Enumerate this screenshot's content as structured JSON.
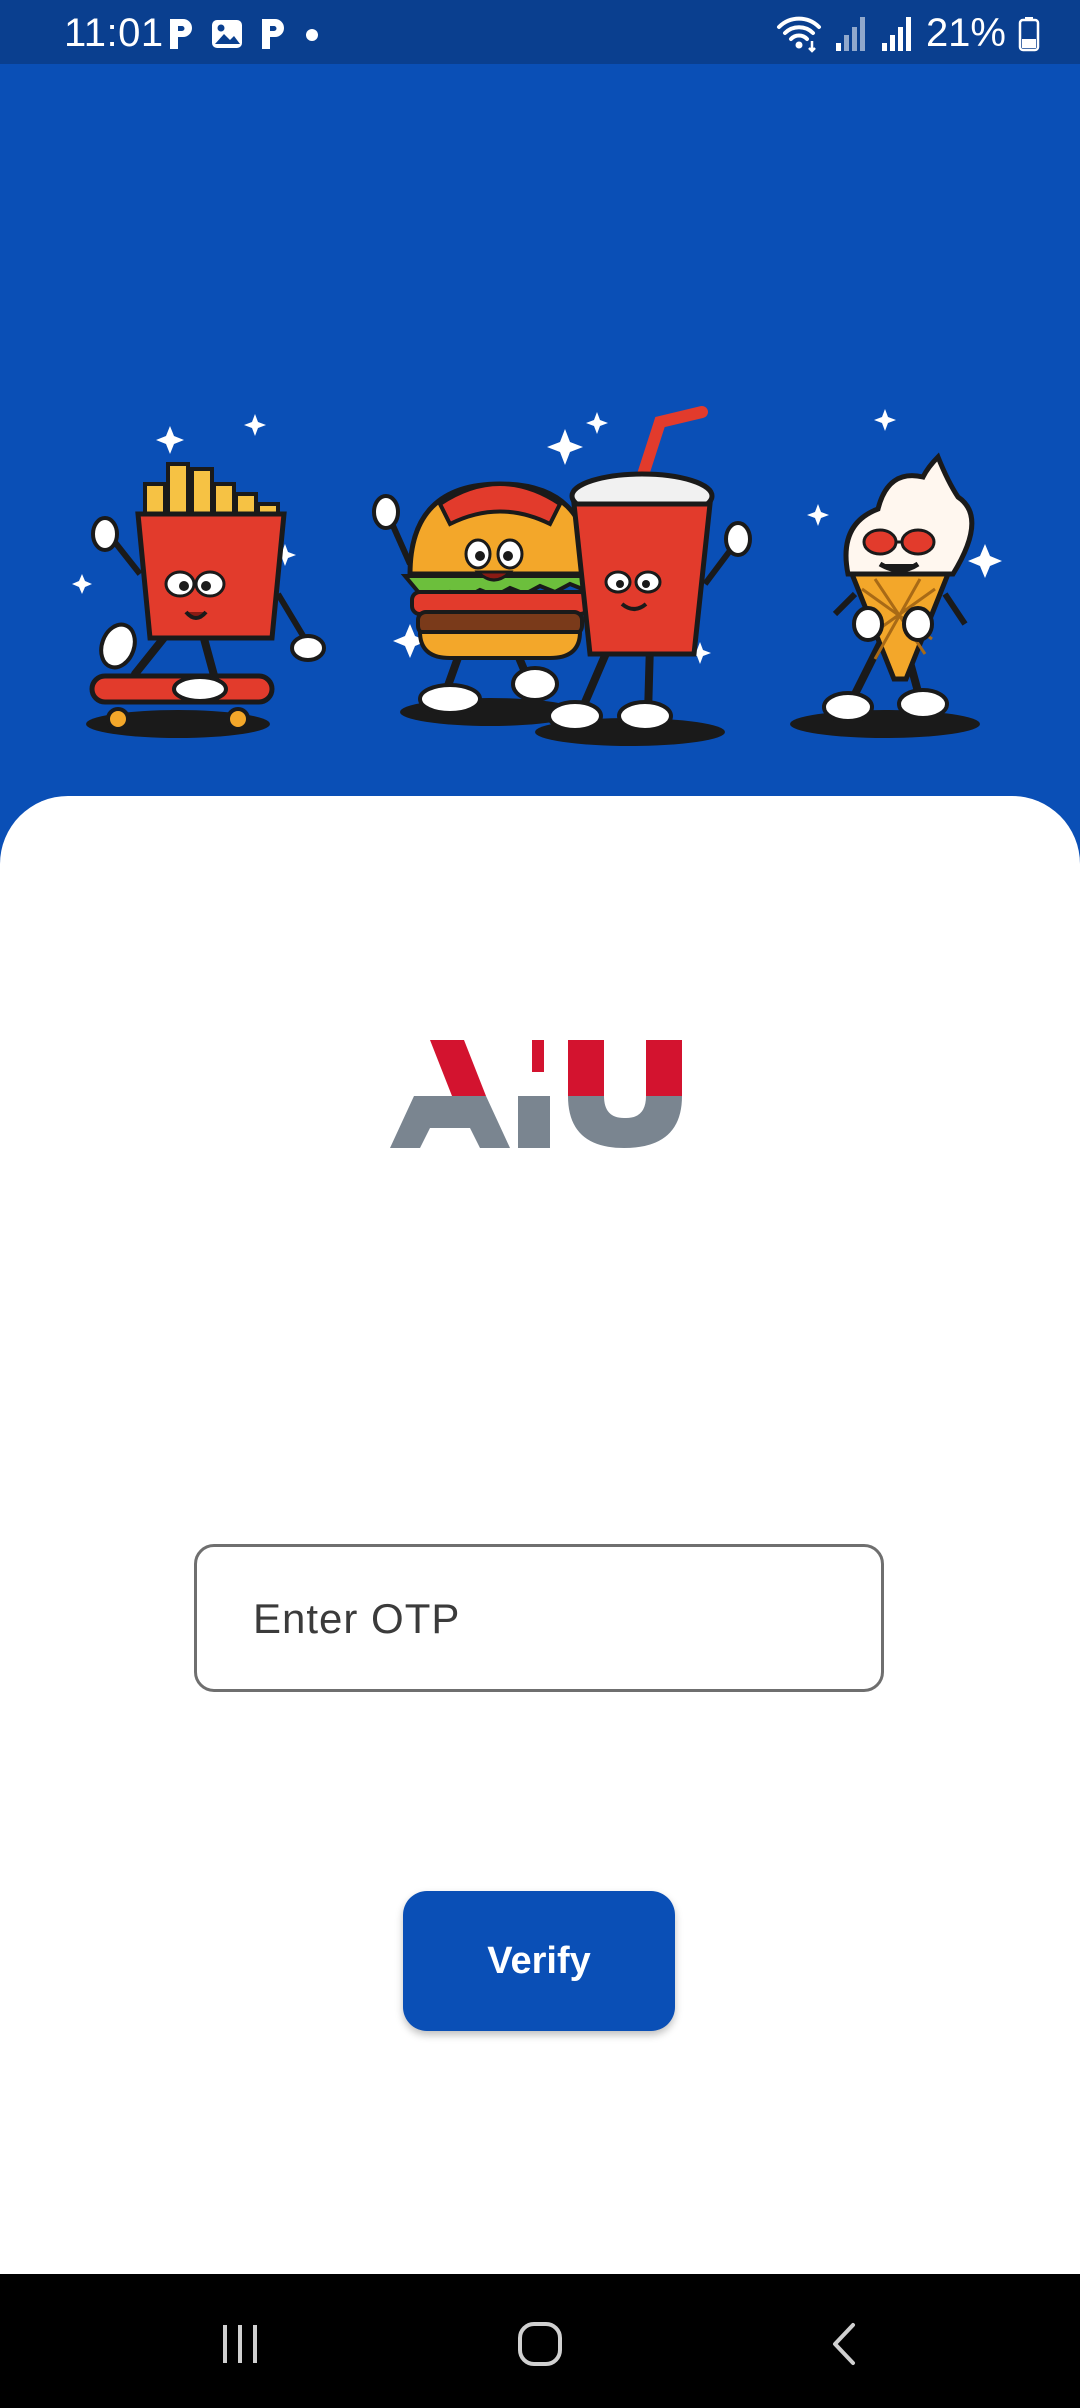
{
  "status_bar": {
    "time": "11:01",
    "battery": "21%",
    "left_icons": [
      "p-icon",
      "gallery-icon",
      "p-icon",
      "dot-icon"
    ],
    "right_icons": [
      "wifi-icon",
      "signal-icon",
      "signal-icon",
      "battery-icon"
    ]
  },
  "brand": {
    "logo_text": "ALU",
    "logo_red": "#d3132f",
    "logo_gray": "#7a8590"
  },
  "otp": {
    "placeholder": "Enter OTP",
    "value": ""
  },
  "verify_button": {
    "label": "Verify"
  },
  "colors": {
    "primary": "#0a4fb6",
    "status_bar": "#0a3f8f",
    "card": "#ffffff"
  },
  "nav_bar": {
    "items": [
      "recents-icon",
      "home-icon",
      "back-icon"
    ]
  }
}
